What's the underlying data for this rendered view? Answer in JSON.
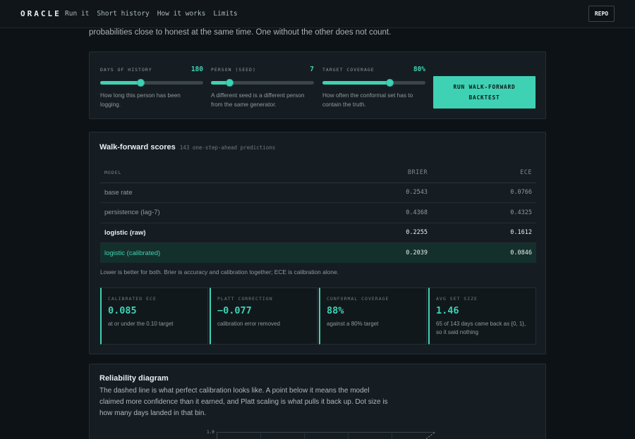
{
  "nav": {
    "brand": "ORACLE",
    "links": [
      "Run it",
      "Short history",
      "How it works",
      "Limits"
    ],
    "repo": "REPO"
  },
  "intro_tail": "probabilities close to honest at the same time. One without the other does not count.",
  "controls": {
    "days": {
      "label": "DAYS OF HISTORY",
      "value": "180",
      "fraction": 0.39,
      "desc": "How long this person has been logging."
    },
    "seed": {
      "label": "PERSON (SEED)",
      "value": "7",
      "fraction": 0.18,
      "desc": "A different seed is a different person from the same generator."
    },
    "coverage": {
      "label": "TARGET COVERAGE",
      "value": "80%",
      "fraction": 0.65,
      "desc": "How often the conformal set has to contain the truth."
    },
    "run_button": [
      "RUN WALK-FORWARD",
      "BACKTEST"
    ]
  },
  "scores": {
    "title": "Walk-forward scores",
    "subtitle": "143 one-step-ahead predictions",
    "headers": {
      "model": "MODEL",
      "brier": "BRIER",
      "ece": "ECE"
    },
    "rows": [
      {
        "model": "base rate",
        "brier": "0.2543",
        "ece": "0.0766"
      },
      {
        "model": "persistence (lag-7)",
        "brier": "0.4368",
        "ece": "0.4325"
      },
      {
        "model": "logistic (raw)",
        "brier": "0.2255",
        "ece": "0.1612"
      },
      {
        "model": "logistic (calibrated)",
        "brier": "0.2039",
        "ece": "0.0846"
      }
    ],
    "note": "Lower is better for both. Brier is accuracy and calibration together; ECE is calibration alone.",
    "stats": [
      {
        "label": "CALIBRATED ECE",
        "value": "0.085",
        "desc": "at or under the 0.10 target"
      },
      {
        "label": "PLATT CORRECTION",
        "value": "−0.077",
        "desc": "calibration error removed"
      },
      {
        "label": "CONFORMAL COVERAGE",
        "value": "88%",
        "desc": "against a 80% target"
      },
      {
        "label": "AVG SET SIZE",
        "value": "1.46",
        "desc": "65 of 143 days came back as {0, 1}, so it said nothing"
      }
    ]
  },
  "reliability": {
    "title": "Reliability diagram",
    "desc": "The dashed line is what perfect calibration looks like. A point below it means the model claimed more confidence than it earned, and Platt scaling is what pulls it back up. Dot size is how many days landed in that bin.",
    "ytick_top": "1.0"
  },
  "colors": {
    "accent": "#3fd1b3",
    "background": "#0d1216",
    "panel": "#151d22"
  }
}
